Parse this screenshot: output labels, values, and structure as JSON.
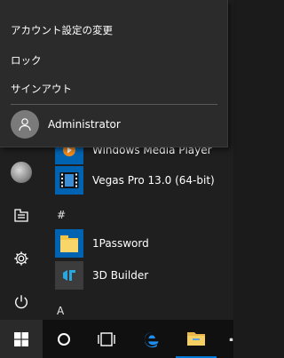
{
  "account_menu": {
    "items": [
      {
        "label": "アカウント設定の変更"
      },
      {
        "label": "ロック"
      },
      {
        "label": "サインアウト"
      }
    ],
    "user_name": "Administrator"
  },
  "app_list": {
    "partial_app": "Windows Media Player",
    "apps_v": [
      {
        "label": "Vegas Pro 13.0 (64-bit)",
        "icon": "vegas-icon"
      }
    ],
    "group_hash": "#",
    "apps_hash": [
      {
        "label": "1Password",
        "icon": "folder-icon"
      },
      {
        "label": "3D Builder",
        "icon": "3d-builder-icon"
      }
    ],
    "group_a": "A"
  },
  "rail": {
    "items": [
      "user-avatar",
      "documents-icon",
      "settings-icon",
      "power-icon"
    ]
  },
  "taskbar": {
    "items": [
      "windows-start-icon",
      "cortana-icon",
      "task-view-icon",
      "edge-icon",
      "file-explorer-icon",
      "store-icon"
    ]
  },
  "colors": {
    "accent_blue": "#0078d7",
    "tile_blue": "#0063b1",
    "popup_bg": "#2b2b2b",
    "menu_bg": "#1f1f1f",
    "taskbar_bg": "#101010",
    "folder_yellow": "#f3c542"
  }
}
